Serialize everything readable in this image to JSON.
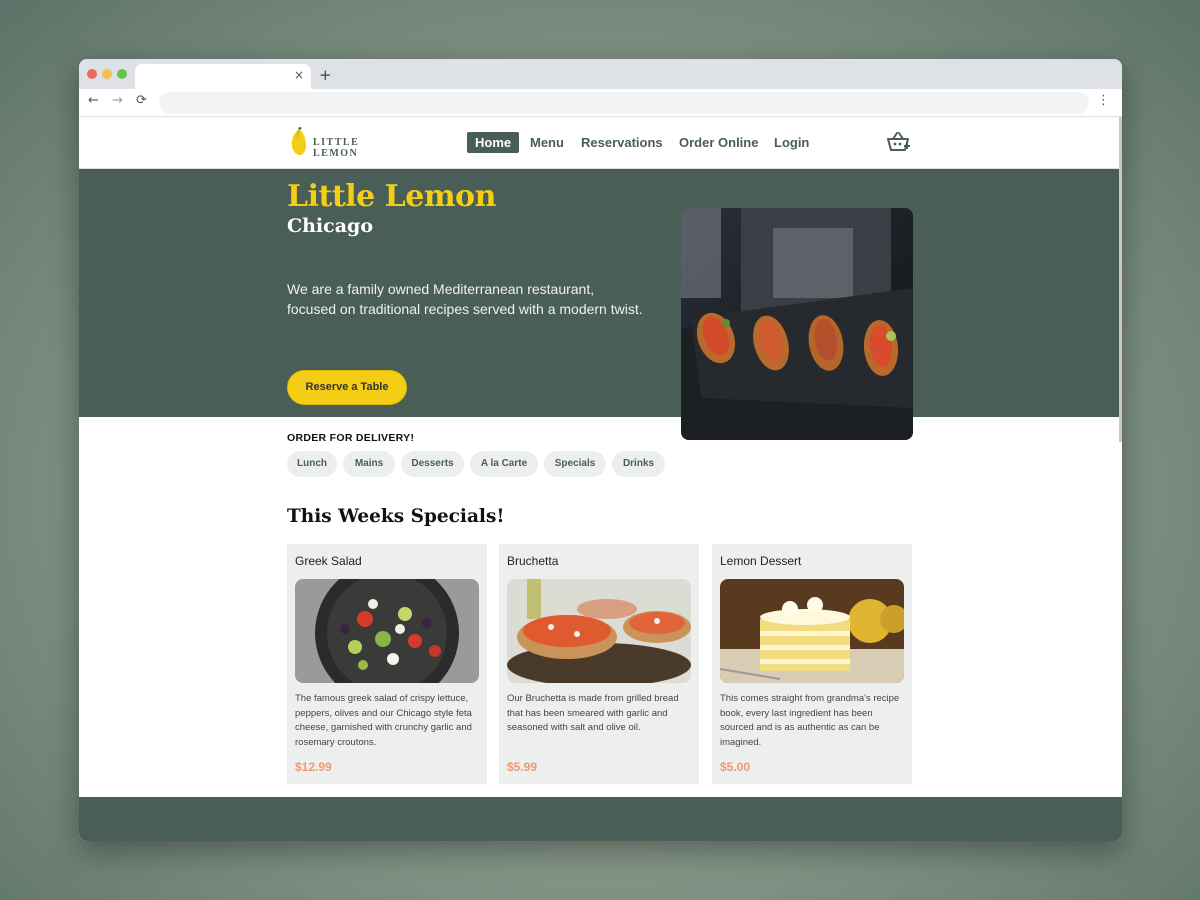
{
  "browser": {
    "tab_close": "×",
    "new_tab": "+",
    "back": "←",
    "forward": "→",
    "reload": "⟳",
    "menu": "⋮"
  },
  "site": {
    "logo_text": "LITTLE LEMON",
    "nav": [
      "Home",
      "Menu",
      "Reservations",
      "Order Online",
      "Login"
    ],
    "active_nav": "Home"
  },
  "hero": {
    "title": "Little Lemon",
    "subtitle": "Chicago",
    "description": "We are a family owned Mediterranean restaurant, focused on traditional recipes served with a modern twist.",
    "cta": "Reserve a Table"
  },
  "delivery": {
    "heading": "ORDER FOR DELIVERY!",
    "categories": [
      "Lunch",
      "Mains",
      "Desserts",
      "A la Carte",
      "Specials",
      "Drinks"
    ]
  },
  "specials": {
    "heading": "This Weeks Specials!",
    "items": [
      {
        "title": "Greek Salad",
        "description": "The famous greek salad of crispy lettuce, peppers, olives and our Chicago style feta cheese, garnished with crunchy garlic and rosemary croutons.",
        "price": "$12.99"
      },
      {
        "title": "Bruchetta",
        "description": "Our Bruchetta is made from grilled bread that has been smeared with garlic and seasoned with salt and olive oil.",
        "price": "$5.99"
      },
      {
        "title": "Lemon Dessert",
        "description": "This comes straight from grandma's recipe book, every last ingredient has been sourced and is as authentic as can be imagined.",
        "price": "$5.00"
      }
    ]
  },
  "colors": {
    "primary_green": "#495e57",
    "primary_yellow": "#f4ce14",
    "price_salmon": "#ee9972",
    "card_gray": "#edefee"
  }
}
